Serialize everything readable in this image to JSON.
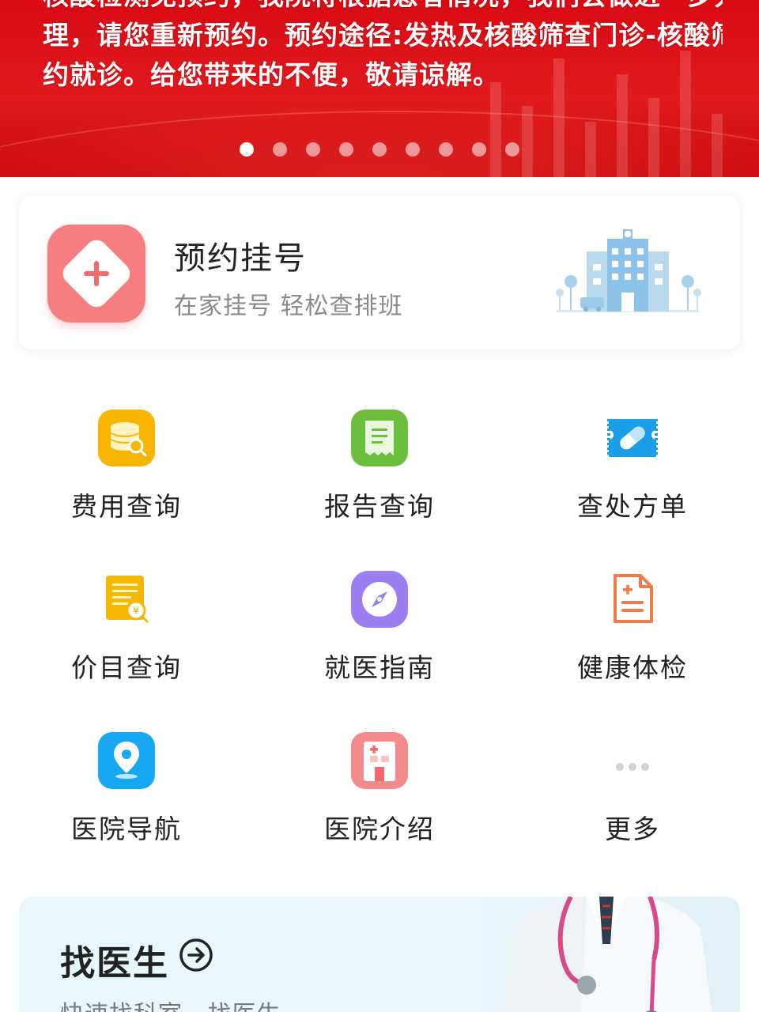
{
  "banner": {
    "lines": [
      "核酸检测免预约，我院将根据患者情况，我们会做进一步处",
      "理，请您重新预约。预约途径:发热及核酸筛查门诊-核酸筛查预",
      "约就诊。给您带来的不便，敬请谅解。"
    ],
    "slide_count": 9,
    "active_slide": 1
  },
  "appointment": {
    "title": "预约挂号",
    "subtitle": "在家挂号 轻松查排班",
    "icon": "plus-diamond-icon",
    "illustration": "hospital-building-illustration"
  },
  "services": [
    {
      "label": "费用查询",
      "icon": "coin-stack-search-icon",
      "color": "#f7b500"
    },
    {
      "label": "报告查询",
      "icon": "report-document-icon",
      "color": "#6bbf3c"
    },
    {
      "label": "查处方单",
      "icon": "pill-ticket-icon",
      "color": "#1a9ee8"
    },
    {
      "label": "价目查询",
      "icon": "price-list-icon",
      "color": "#f5b700"
    },
    {
      "label": "就医指南",
      "icon": "compass-icon",
      "color": "#9b7ef0"
    },
    {
      "label": "健康体检",
      "icon": "medical-report-icon",
      "color": "#f07a4a"
    },
    {
      "label": "医院导航",
      "icon": "location-pin-icon",
      "color": "#16a8f0"
    },
    {
      "label": "医院介绍",
      "icon": "hospital-building-icon",
      "color": "#f36a6d"
    },
    {
      "label": "更多",
      "icon": "more-dots-icon",
      "color": "#cccccc"
    }
  ],
  "find_doctor": {
    "title": "找医生",
    "subtitle": "快速找科室   找医生",
    "arrow_icon": "arrow-right-circle-icon",
    "illustration": "doctor-illustration"
  }
}
